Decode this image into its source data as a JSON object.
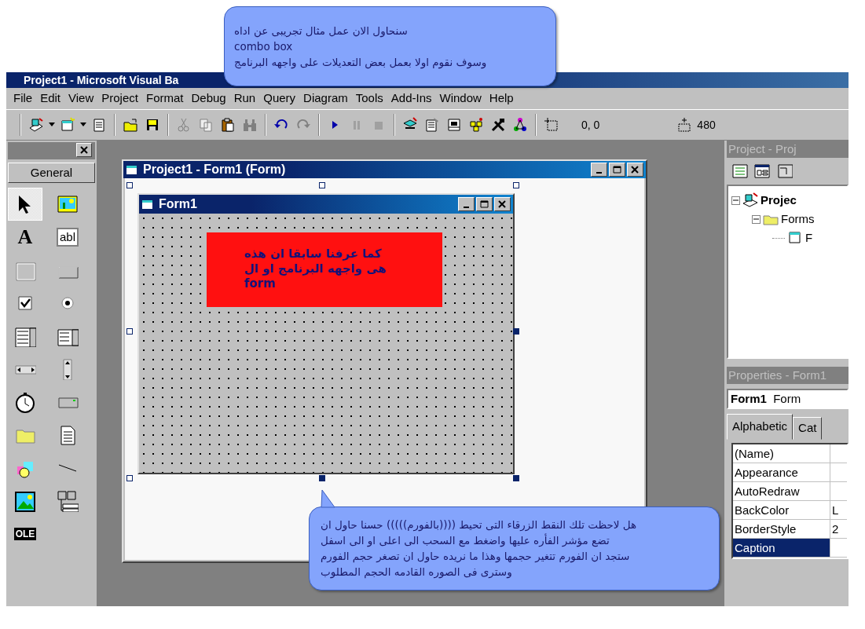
{
  "window": {
    "title": "Project1 - Microsoft Visual Ba"
  },
  "menu": [
    "File",
    "Edit",
    "View",
    "Project",
    "Format",
    "Debug",
    "Run",
    "Query",
    "Diagram",
    "Tools",
    "Add-Ins",
    "Window",
    "Help"
  ],
  "toolbar": {
    "position": "0, 0",
    "size": "480"
  },
  "toolbox": {
    "tab": "General",
    "items": [
      {
        "kind": "pointer",
        "selected": true
      },
      {
        "kind": "picture",
        "selected": false
      },
      {
        "kind": "label",
        "text": "A",
        "selected": false
      },
      {
        "kind": "textbox",
        "text": "abl",
        "selected": false
      },
      {
        "kind": "frame",
        "selected": false
      },
      {
        "kind": "command",
        "selected": false
      },
      {
        "kind": "checkbox",
        "selected": false
      },
      {
        "kind": "option",
        "selected": false
      },
      {
        "kind": "combo",
        "selected": false
      },
      {
        "kind": "list",
        "selected": false
      },
      {
        "kind": "hscroll",
        "selected": false
      },
      {
        "kind": "vscroll",
        "selected": false
      },
      {
        "kind": "timer",
        "selected": false
      },
      {
        "kind": "drive",
        "selected": false
      },
      {
        "kind": "dir",
        "selected": false
      },
      {
        "kind": "file",
        "selected": false
      },
      {
        "kind": "shape",
        "selected": false
      },
      {
        "kind": "line",
        "selected": false
      },
      {
        "kind": "image",
        "selected": false
      },
      {
        "kind": "data",
        "selected": false
      },
      {
        "kind": "ole",
        "text": "OLE",
        "selected": false
      }
    ]
  },
  "designer": {
    "title": "Project1 - Form1 (Form)",
    "form_title": "Form1",
    "label_lines": [
      "كما عرفنا سابقا ان هذه",
      "هى واجهه البرنامج او ال",
      "form"
    ]
  },
  "project_panel": {
    "title": "Project - Proj",
    "tree": [
      {
        "label": "Projec",
        "expanded": true,
        "children": [
          {
            "label": "Forms",
            "expanded": true,
            "children": [
              {
                "label": "F"
              }
            ]
          }
        ]
      }
    ]
  },
  "properties_panel": {
    "title": "Properties - Form1",
    "object": {
      "name": "Form1",
      "type": "Form"
    },
    "tabs": [
      {
        "label": "Alphabetic",
        "selected": true
      },
      {
        "label": "Cat",
        "selected": false
      }
    ],
    "rows": [
      {
        "name": "(Name)",
        "selected": false
      },
      {
        "name": "Appearance",
        "selected": false
      },
      {
        "name": "AutoRedraw",
        "selected": false
      },
      {
        "name": "BackColor",
        "value": "L",
        "selected": false
      },
      {
        "name": "BorderStyle",
        "value": "2",
        "selected": false
      },
      {
        "name": "Caption",
        "selected": true
      }
    ]
  },
  "callouts": [
    {
      "lines": [
        "سنحاول الان عمل مثال تجريبى عن اداه",
        "combo box",
        "وسوف نقوم اولا بعمل بعض التعديلات على واجهه البرنامج"
      ]
    },
    {
      "lines": [
        "هل لاحظت تلك النقط الزرقاء التى تحيط ((((بالفورم))))) حسنا حاول ان",
        "تضع مؤشر الفأره عليها واضغط مع السحب  الى اعلى او الى اسفل",
        "ستجد ان الفورم تتغير حجمها وهذا ما نريده حاول ان تصغر حجم الفورم",
        "وسترى فى الصوره القادمه الحجم المطلوب"
      ]
    }
  ]
}
